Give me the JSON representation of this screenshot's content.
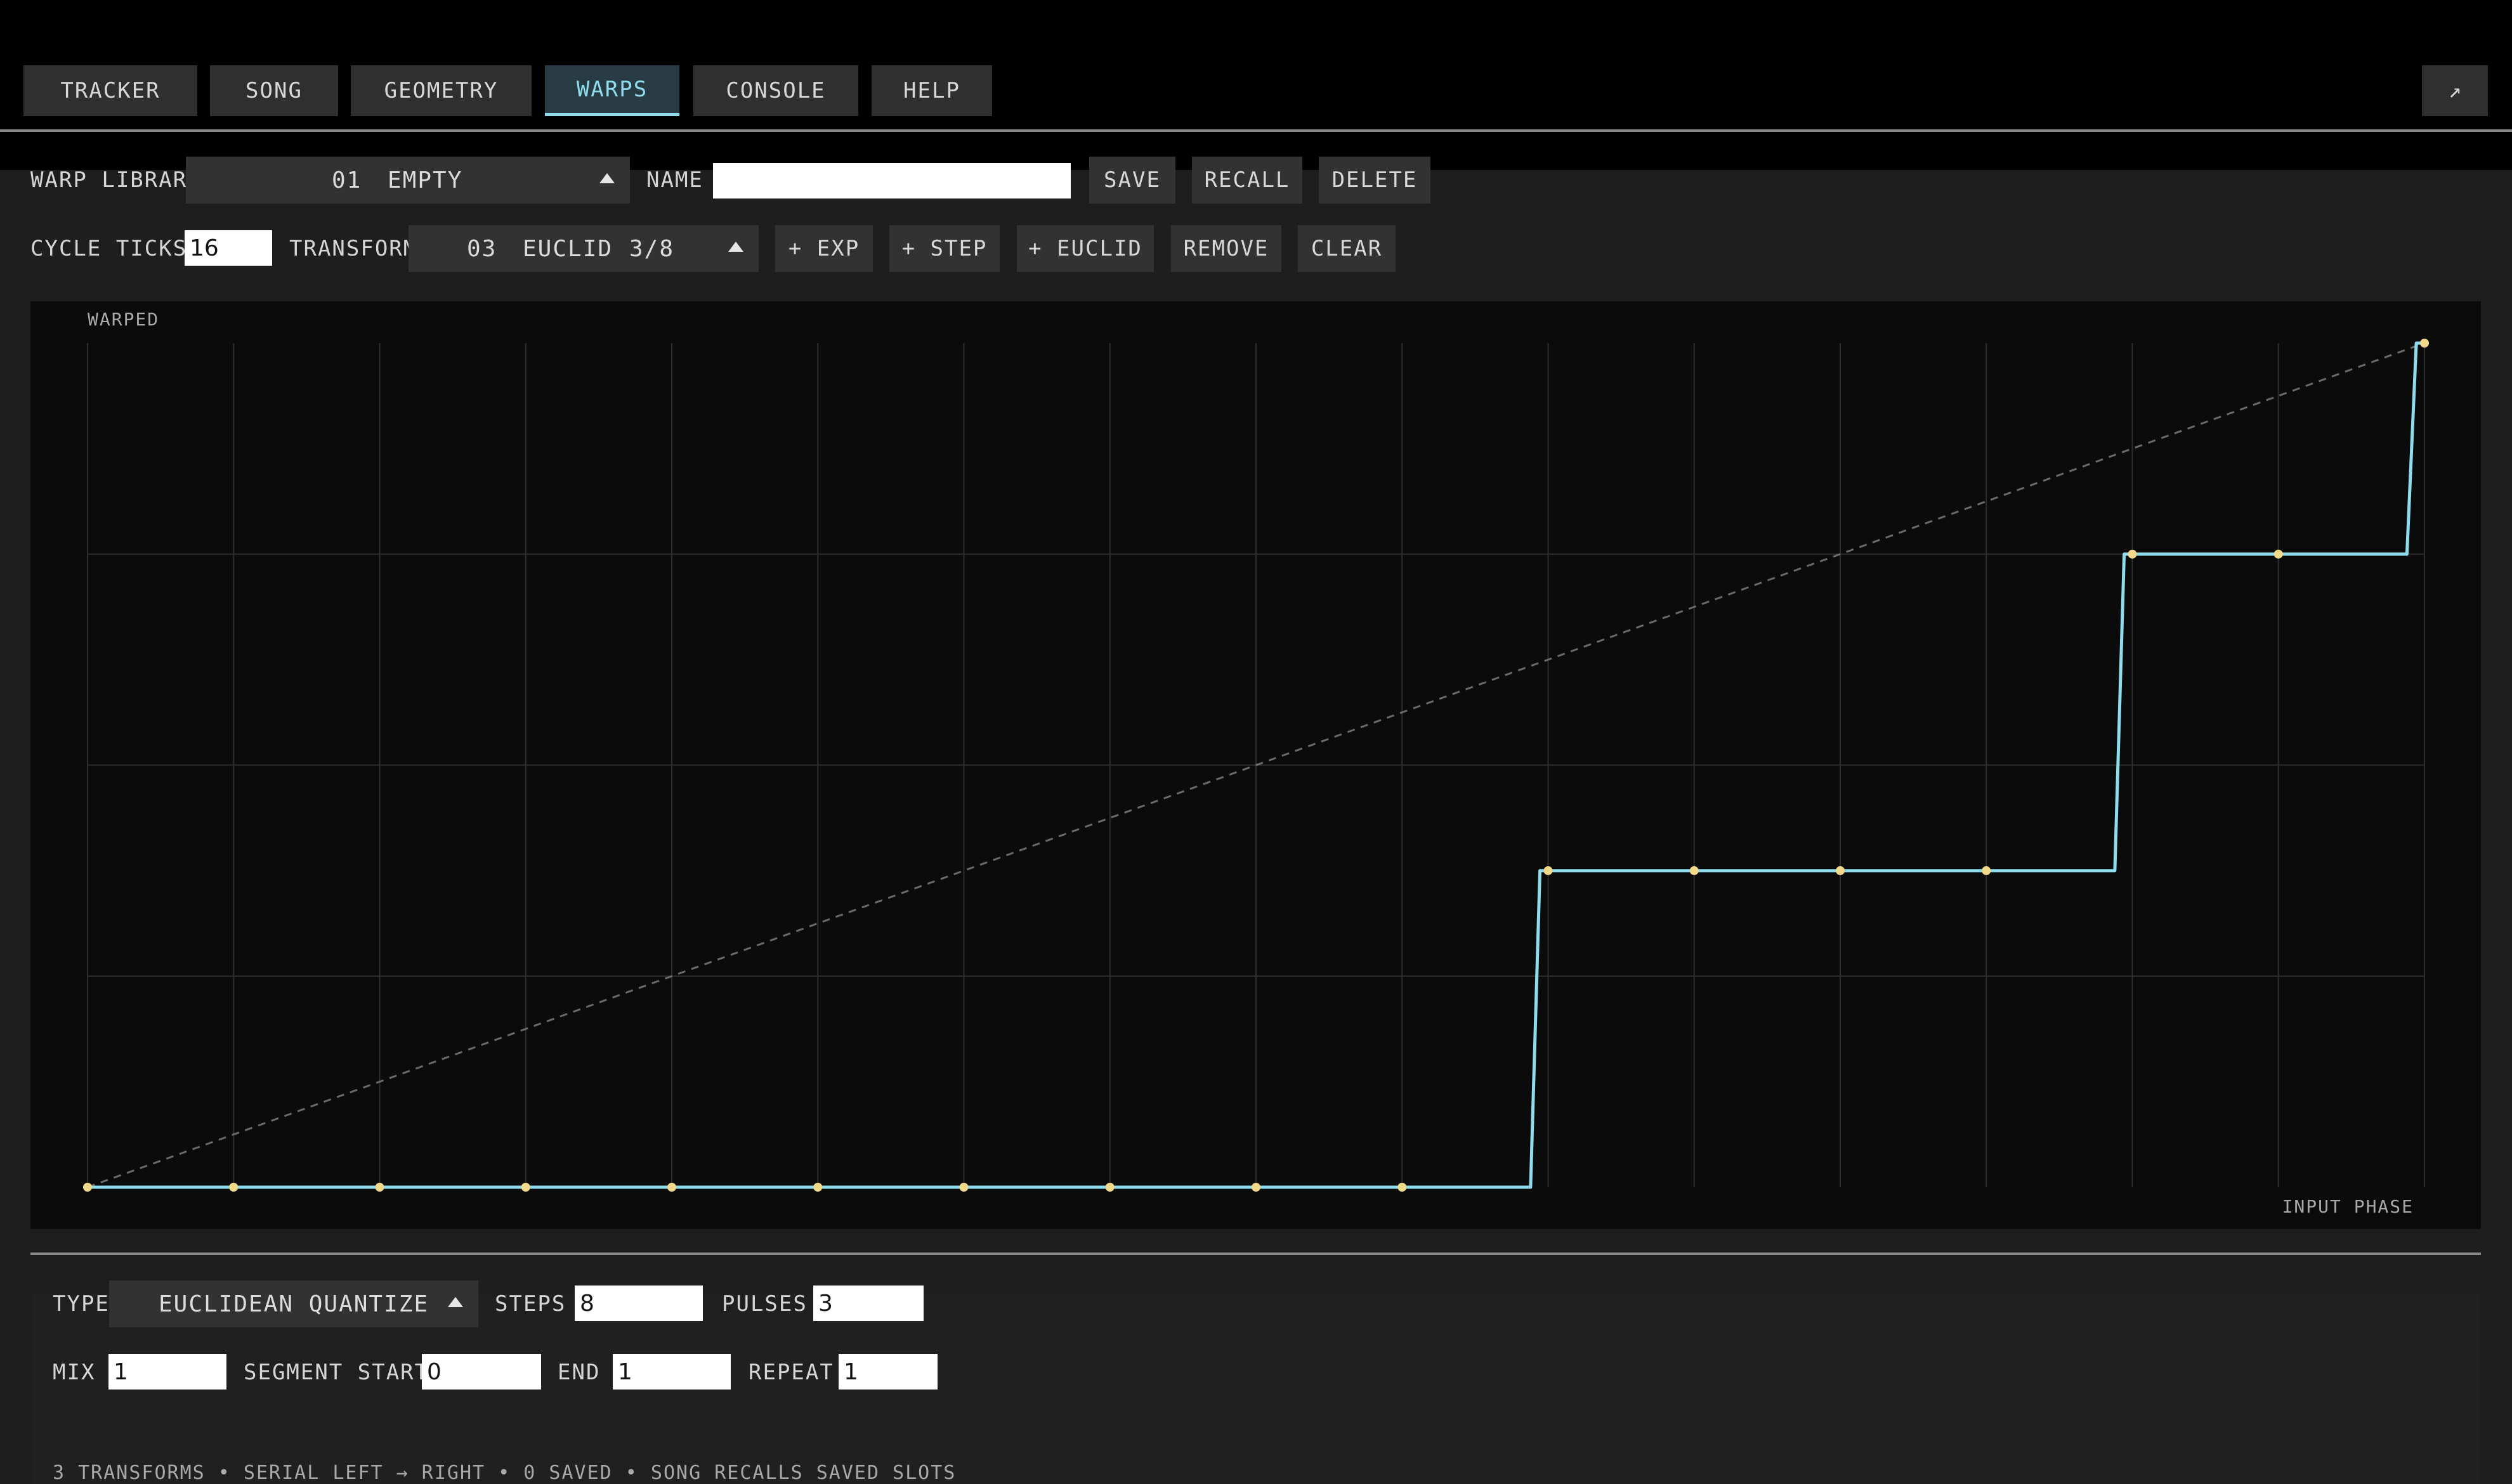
{
  "nav": {
    "tabs": [
      {
        "label": "TRACKER"
      },
      {
        "label": "SONG"
      },
      {
        "label": "GEOMETRY"
      },
      {
        "label": "WARPS"
      },
      {
        "label": "CONSOLE"
      },
      {
        "label": "HELP"
      }
    ],
    "active_tab": "WARPS",
    "expand_icon": "arrow-up-right-icon",
    "expand_glyph": "↗"
  },
  "library": {
    "label": "WARP LIBRARY",
    "selected_number": "01",
    "selected_name": "EMPTY",
    "name_label": "NAME",
    "name_value": "",
    "save_label": "SAVE",
    "recall_label": "RECALL",
    "delete_label": "DELETE"
  },
  "transform_bar": {
    "cycle_ticks_label": "CYCLE TICKS",
    "cycle_ticks_value": "16",
    "transform_label": "TRANSFORM",
    "selected_number": "03",
    "selected_name": "EUCLID",
    "selected_ratio": "3/8",
    "add_exp_label": "+ EXP",
    "add_step_label": "+ STEP",
    "add_euclid_label": "+ EUCLID",
    "remove_label": "REMOVE",
    "clear_label": "CLEAR"
  },
  "plot": {
    "y_axis_label": "WARPED",
    "x_axis_label": "INPUT PHASE",
    "curve_color": "#8fdcec",
    "point_color": "#f2da8a",
    "grid_color": "#2e2e2e",
    "identity_color": "#6a6a6a"
  },
  "chart_data": {
    "type": "line",
    "xlabel": "INPUT PHASE",
    "ylabel": "WARPED",
    "xlim": [
      0,
      1
    ],
    "ylim": [
      0,
      1
    ],
    "grid": true,
    "x_divisions": 16,
    "y_divisions": 4,
    "series": [
      {
        "role": "warped",
        "x": [
          0,
          0.0625,
          0.125,
          0.1875,
          0.25,
          0.3125,
          0.375,
          0.4375,
          0.5,
          0.5625,
          0.625,
          0.6875,
          0.75,
          0.8125,
          0.875,
          0.9375,
          1
        ],
        "y": [
          0,
          0,
          0,
          0,
          0,
          0,
          0,
          0,
          0,
          0,
          0.375,
          0.375,
          0.375,
          0.375,
          0.75,
          0.75,
          1
        ]
      },
      {
        "role": "identity",
        "x": [
          0,
          1
        ],
        "y": [
          0,
          1
        ]
      }
    ]
  },
  "transform_panel": {
    "type_label": "TYPE",
    "type_value": "EUCLIDEAN QUANTIZE",
    "steps_label": "STEPS",
    "steps_value": "8",
    "pulses_label": "PULSES",
    "pulses_value": "3",
    "mix_label": "MIX",
    "mix_value": "1",
    "segment_start_label": "SEGMENT START",
    "segment_start_value": "0",
    "end_label": "END",
    "end_value": "1",
    "repeat_label": "REPEAT",
    "repeat_value": "1"
  },
  "status": {
    "text": "3 TRANSFORMS • SERIAL LEFT → RIGHT • 0 SAVED • SONG RECALLS SAVED SLOTS"
  }
}
